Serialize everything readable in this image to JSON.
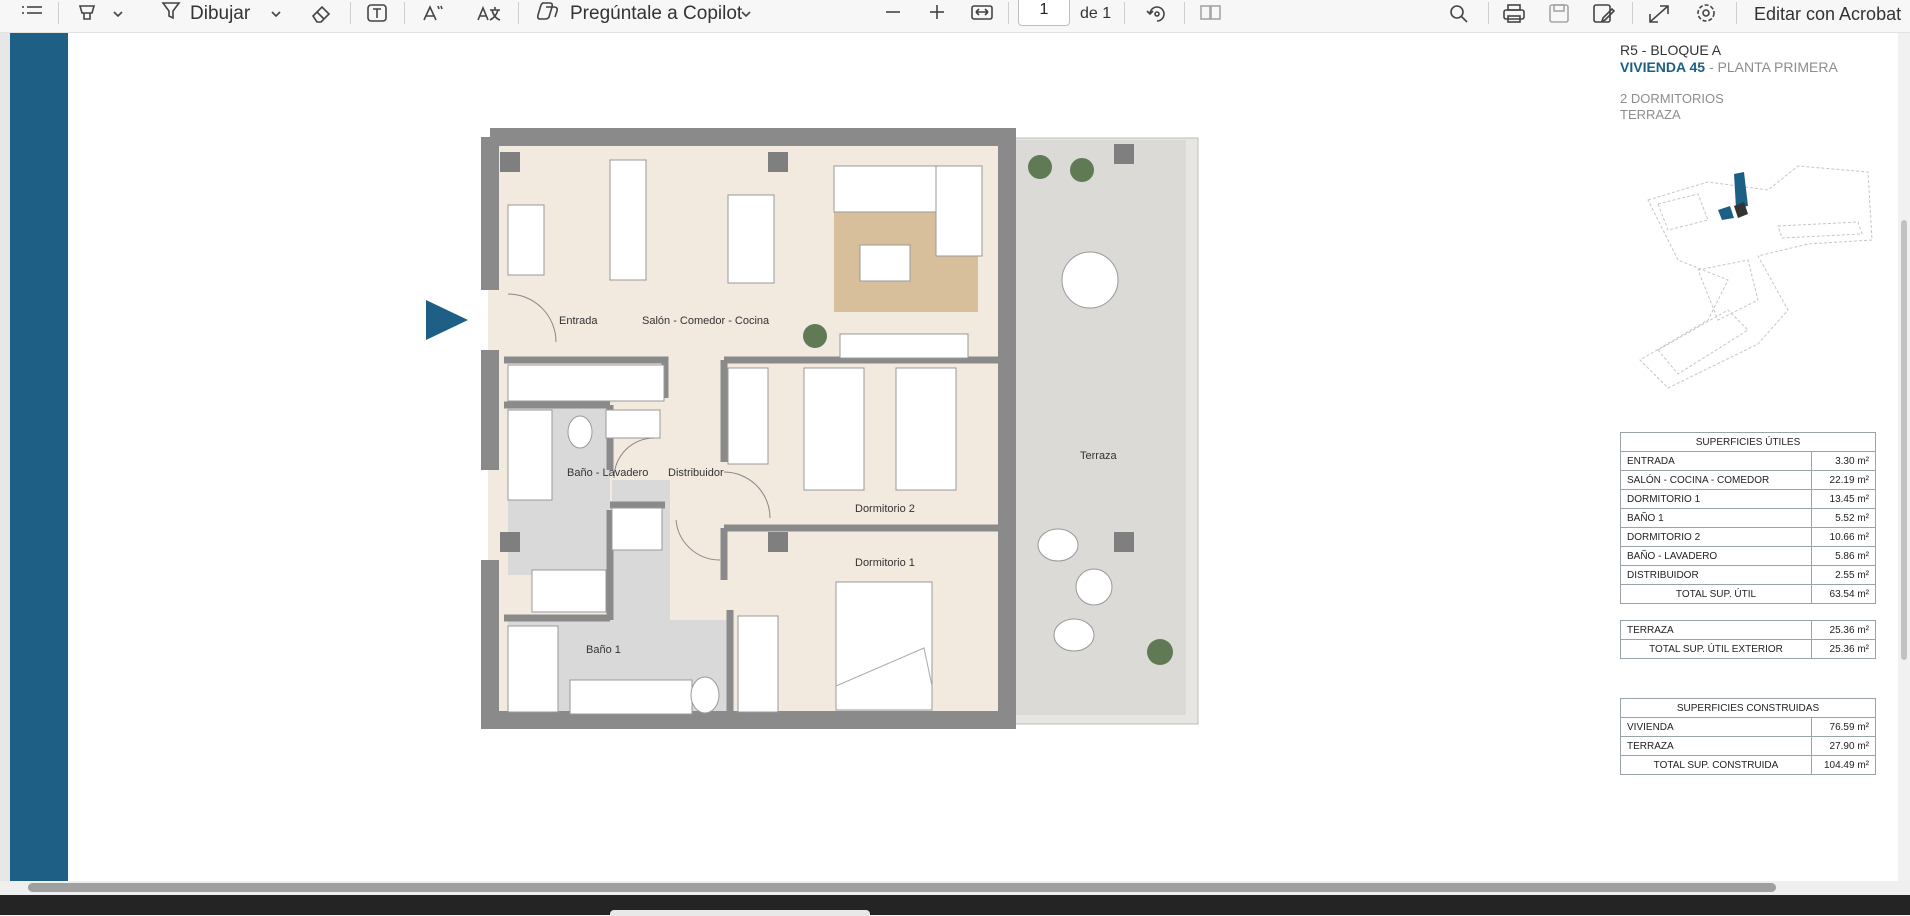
{
  "toolbar": {
    "draw_label": "Dibujar",
    "copilot_label": "Pregúntale a Copilot",
    "page_current": "1",
    "page_total": "de 1",
    "edit_label": "Editar con Acrobat",
    "icons": [
      "list-icon",
      "highlighter-icon",
      "chevron-down-icon",
      "draw-icon",
      "chevron-down-icon",
      "eraser-icon",
      "text-box-icon",
      "read-aloud-icon",
      "translate-icon",
      "copilot-icon",
      "chevron-down-icon",
      "zoom-out-icon",
      "zoom-in-icon",
      "fit-page-icon",
      "rotate-icon",
      "two-page-icon",
      "search-icon",
      "print-icon",
      "save-icon",
      "save-as-icon",
      "expand-icon",
      "settings-icon"
    ]
  },
  "header": {
    "line1": "R5 - BLOQUE A",
    "unit": "VIVIENDA 45",
    "floor": " - PLANTA PRIMERA",
    "line3": "2 DORMITORIOS",
    "line4": "TERRAZA"
  },
  "colors": {
    "accent": "#1d5f85",
    "unit_blue": "#1d5f85",
    "grey": "#8d8d8d"
  },
  "plan": {
    "rooms": {
      "entrada": "Entrada",
      "salon": "Salón - Comedor - Cocina",
      "bano_lavadero": "Baño - Lavadero",
      "distribuidor": "Distribuidor",
      "dormitorio2": "Dormitorio 2",
      "dormitorio1": "Dormitorio 1",
      "bano1": "Baño 1",
      "terraza": "Terraza"
    }
  },
  "superficies_utiles": {
    "title": "SUPERFICIES ÚTILES",
    "rows": [
      {
        "label": "ENTRADA",
        "value": "3.30 m²"
      },
      {
        "label": "SALÓN - COCINA - COMEDOR",
        "value": "22.19 m²"
      },
      {
        "label": "DORMITORIO 1",
        "value": "13.45 m²"
      },
      {
        "label": "BAÑO 1",
        "value": "5.52 m²"
      },
      {
        "label": "DORMITORIO 2",
        "value": "10.66 m²"
      },
      {
        "label": "BAÑO - LAVADERO",
        "value": "5.86 m²"
      },
      {
        "label": "DISTRIBUIDOR",
        "value": "2.55 m²"
      }
    ],
    "total_label": "TOTAL SUP. ÚTIL",
    "total_value": "63.54 m²"
  },
  "exterior": {
    "rows": [
      {
        "label": "TERRAZA",
        "value": "25.36 m²"
      }
    ],
    "total_label": "TOTAL SUP. ÚTIL EXTERIOR",
    "total_value": "25.36 m²"
  },
  "construidas": {
    "title": "SUPERFICIES CONSTRUIDAS",
    "rows": [
      {
        "label": "VIVIENDA",
        "value": "76.59 m²"
      },
      {
        "label": "TERRAZA",
        "value": "27.90 m²"
      }
    ],
    "total_label": "TOTAL SUP. CONSTRUIDA",
    "total_value": "104.49 m²"
  }
}
